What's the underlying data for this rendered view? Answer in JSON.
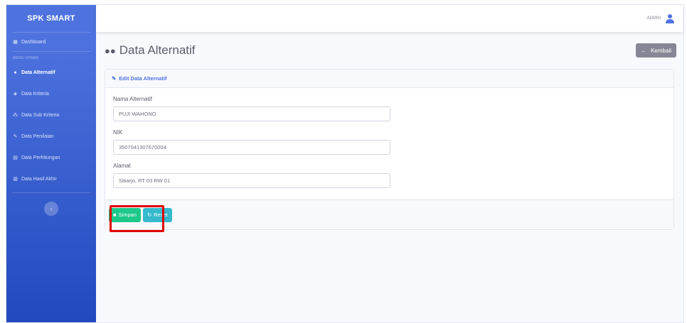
{
  "brand": "SPK SMART",
  "sidebar": {
    "items": [
      {
        "label": "Dashboard",
        "icon": "dashboard-icon"
      },
      {
        "label": "Data Alternatif",
        "icon": "users-icon"
      },
      {
        "label": "Data Kriteria",
        "icon": "cube-icon"
      },
      {
        "label": "Data Sub Kriteria",
        "icon": "cubes-icon"
      },
      {
        "label": "Data Penilaian",
        "icon": "edit-icon"
      },
      {
        "label": "Data Perhitungan",
        "icon": "calculator-icon"
      },
      {
        "label": "Data Hasil Akhir",
        "icon": "chart-icon"
      }
    ],
    "heading": "MENU UTAMA"
  },
  "topbar": {
    "user_name": "ADMIN"
  },
  "page": {
    "title": "Data Alternatif",
    "back_label": "Kembali"
  },
  "card": {
    "header": "Edit Data Alternatif",
    "fields": [
      {
        "label": "Nama Alternatif",
        "value": "PUJI WAHONO"
      },
      {
        "label": "NIK",
        "value": "3507041307670004"
      },
      {
        "label": "Alamat",
        "value": "Sitiarjo, RT 03 RW 01"
      }
    ],
    "save_label": "Simpan",
    "reset_label": "Reset"
  },
  "colors": {
    "primary": "#4e73df",
    "success": "#1cc88a",
    "info": "#36b9cc",
    "secondary": "#858796",
    "highlight": "#e00000"
  }
}
